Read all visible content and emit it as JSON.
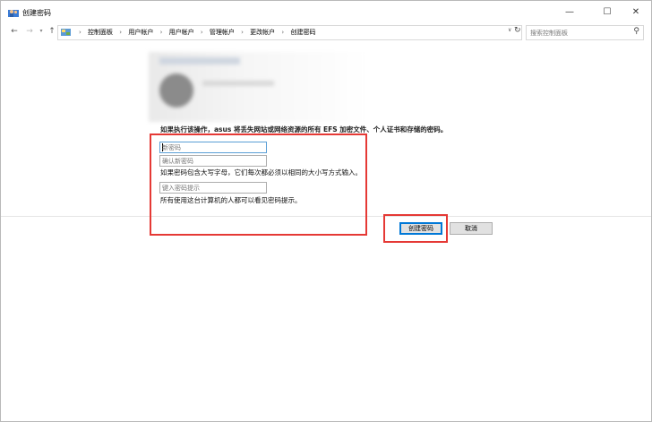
{
  "window": {
    "title": "创建密码",
    "controls": {
      "minimize": "—",
      "maximize": "☐",
      "close": "✕"
    }
  },
  "nav": {
    "back": "←",
    "forward": "→",
    "recent": "▾",
    "up": "↑"
  },
  "address": {
    "breadcrumbs": [
      "控制面板",
      "用户帐户",
      "用户帐户",
      "管理帐户",
      "更改帐户",
      "创建密码"
    ],
    "separator": "›",
    "dropdown": "∨",
    "refresh": "↻"
  },
  "search": {
    "placeholder": "搜索控制面板",
    "icon": "⚲"
  },
  "content": {
    "warning": "如果执行该操作，asus 将丢失网站或网络资源的所有 EFS 加密文件、个人证书和存储的密码。",
    "new_password_placeholder": "新密码",
    "confirm_password_placeholder": "确认新密码",
    "case_hint": "如果密码包含大写字母，它们每次都必须以相同的大小写方式输入。",
    "password_hint_placeholder": "键入密码提示",
    "hint_visibility": "所有使用这台计算机的人都可以看见密码提示。"
  },
  "buttons": {
    "create": "创建密码",
    "cancel": "取消"
  },
  "colors": {
    "highlight": "#e53935",
    "default_button_border": "#0078d7",
    "focus_border": "#5a9fd6"
  }
}
